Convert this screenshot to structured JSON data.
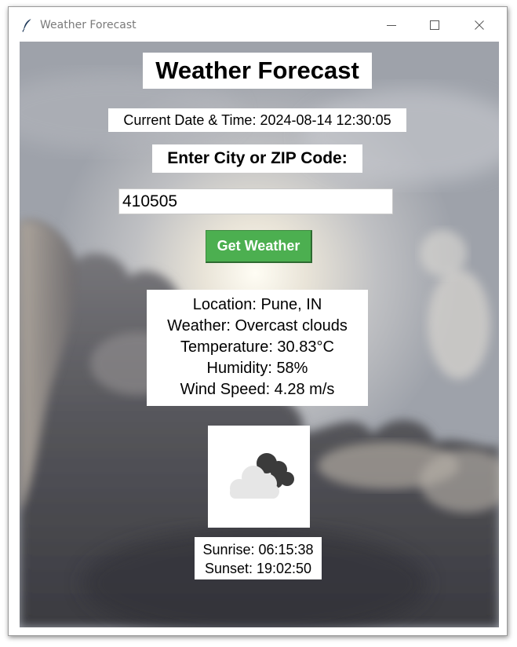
{
  "window": {
    "title": "Weather Forecast",
    "app_icon": "feather-icon",
    "controls": [
      "minimize-icon",
      "maximize-icon",
      "close-icon"
    ]
  },
  "app": {
    "heading": "Weather Forecast",
    "datetime": "Current Date & Time: 2024-08-14 12:30:05",
    "prompt": "Enter City or ZIP Code:",
    "city_input_value": "410505",
    "button_label": "Get Weather"
  },
  "weather": {
    "location": "Location: Pune, IN",
    "description": "Weather: Overcast clouds",
    "temperature": "Temperature: 30.83°C",
    "humidity": "Humidity: 58%",
    "wind": "Wind Speed: 4.28 m/s",
    "icon": "overcast-clouds-icon"
  },
  "sun": {
    "sunrise": "Sunrise: 06:15:38",
    "sunset": "Sunset: 19:02:50"
  },
  "colors": {
    "button_bg": "#4caf50",
    "button_text": "#ffffff",
    "label_bg": "#ffffff",
    "title_text": "#7a7a7a"
  }
}
